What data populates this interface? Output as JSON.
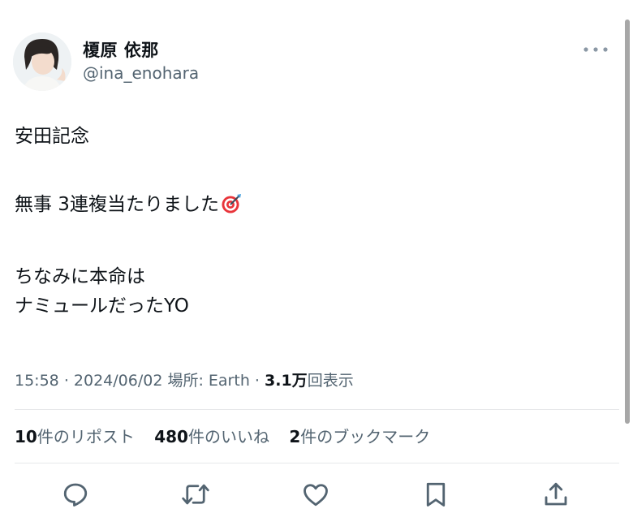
{
  "user": {
    "display_name": "榎原 依那",
    "handle": "@ina_enohara"
  },
  "tweet": {
    "line1": "安田記念",
    "line2": "無事 3連複当たりました",
    "line3": "ちなみに本命は",
    "line4": "ナミュールだったYO",
    "emoji_icon": "direct-hit-target-icon"
  },
  "meta": {
    "time": "15:58",
    "sep1": "·",
    "date": "2024/06/02",
    "location": "場所: Earth",
    "sep2": "·",
    "views_count": "3.1万",
    "views_label": "回表示"
  },
  "stats": {
    "reposts_count": "10",
    "reposts_label": "件のリポスト",
    "likes_count": "480",
    "likes_label": "件のいいね",
    "bookmarks_count": "2",
    "bookmarks_label": "件のブックマーク"
  },
  "actions": {
    "reply_icon": "reply-icon",
    "repost_icon": "repost-icon",
    "like_icon": "heart-icon",
    "bookmark_icon": "bookmark-icon",
    "share_icon": "share-icon"
  },
  "colors": {
    "text": "#0f1419",
    "secondary": "#536471",
    "divider": "#e6e8ea"
  }
}
